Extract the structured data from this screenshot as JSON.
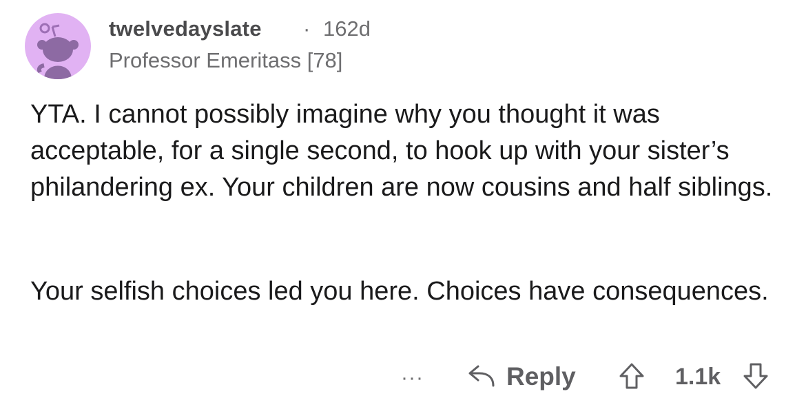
{
  "comment": {
    "author": {
      "username": "twelvedayslate",
      "flair": "Professor Emeritass [78]",
      "avatar_icon": "snoo-avatar-icon",
      "avatar_color": "#e1b2f3"
    },
    "separator": "·",
    "age": "162d",
    "body": [
      "YTA. I cannot possibly imagine why you thought it was acceptable, for a single second, to hook up with your sister’s philandering ex. Your children are now cousins and half siblings.",
      "Your selfish choices led you here. Choices have consequences."
    ],
    "actions": {
      "more_label": "···",
      "more_icon": "more-options-icon",
      "reply_label": "Reply",
      "reply_icon": "reply-arrow-icon",
      "upvote_icon": "upvote-arrow-icon",
      "score": "1.1k",
      "downvote_icon": "downvote-arrow-icon"
    }
  }
}
